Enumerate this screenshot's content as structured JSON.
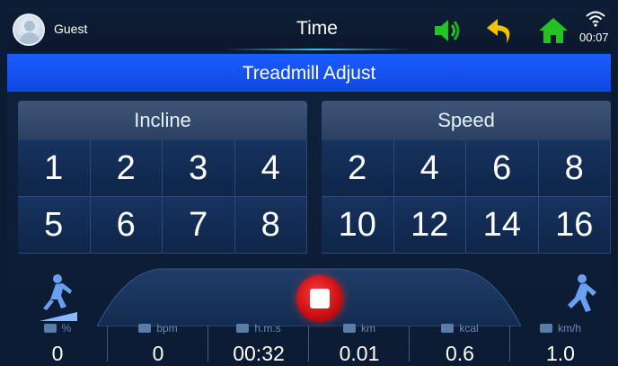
{
  "header": {
    "user_name": "Guest",
    "title": "Time",
    "time": "00:07",
    "icons": [
      "avatar-icon",
      "volume-icon",
      "back-icon",
      "home-icon",
      "wifi-icon"
    ],
    "accent": "#22c322"
  },
  "band": {
    "title": "Treadmill Adjust",
    "color": "#1b5cff"
  },
  "incline": {
    "label": "Incline",
    "values": [
      "1",
      "2",
      "3",
      "4",
      "5",
      "6",
      "7",
      "8"
    ]
  },
  "speed": {
    "label": "Speed",
    "values": [
      "2",
      "4",
      "6",
      "8",
      "10",
      "12",
      "14",
      "16"
    ]
  },
  "stats": [
    {
      "unit": "%",
      "value": "0"
    },
    {
      "unit": "bpm",
      "value": "0"
    },
    {
      "unit": "h.m.s",
      "value": "00:32"
    },
    {
      "unit": "km",
      "value": "0.01"
    },
    {
      "unit": "kcal",
      "value": "0.6"
    },
    {
      "unit": "km/h",
      "value": "1.0"
    }
  ]
}
